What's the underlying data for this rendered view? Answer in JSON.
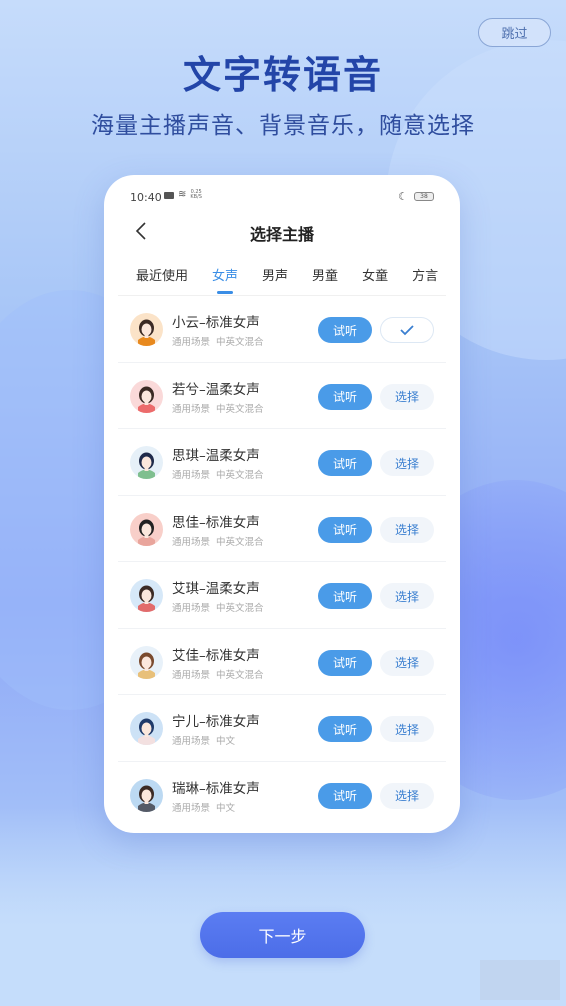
{
  "header": {
    "skip_label": "跳过",
    "title": "文字转语音",
    "subtitle": "海量主播声音、背景音乐，随意选择"
  },
  "phone": {
    "status_bar": {
      "time": "10:40",
      "net_speed_value": "0.25",
      "net_speed_unit": "KB/S",
      "battery": "38"
    },
    "nav": {
      "back_icon": "chevron-left-icon",
      "title": "选择主播"
    },
    "tabs": [
      {
        "label": "最近使用",
        "active": false
      },
      {
        "label": "女声",
        "active": true
      },
      {
        "label": "男声",
        "active": false
      },
      {
        "label": "男童",
        "active": false
      },
      {
        "label": "女童",
        "active": false
      },
      {
        "label": "方言",
        "active": false
      }
    ],
    "voices": [
      {
        "name": "小云–标准女声",
        "tags": [
          "通用场景",
          "中英文混合"
        ],
        "listen_label": "试听",
        "select_label": "✓",
        "selected": true,
        "avatar_bg": "#fbe3c8",
        "hair": "#3b2a24",
        "cloth": "#e8891e"
      },
      {
        "name": "若兮–温柔女声",
        "tags": [
          "通用场景",
          "中英文混合"
        ],
        "listen_label": "试听",
        "select_label": "选择",
        "selected": false,
        "avatar_bg": "#fad9d9",
        "hair": "#3b2a24",
        "cloth": "#ec6b6b"
      },
      {
        "name": "思琪–温柔女声",
        "tags": [
          "通用场景",
          "中英文混合"
        ],
        "listen_label": "试听",
        "select_label": "选择",
        "selected": false,
        "avatar_bg": "#e6f0f8",
        "hair": "#1f2a4a",
        "cloth": "#7fbf8f"
      },
      {
        "name": "思佳–标准女声",
        "tags": [
          "通用场景",
          "中英文混合"
        ],
        "listen_label": "试听",
        "select_label": "选择",
        "selected": false,
        "avatar_bg": "#f8cfc9",
        "hair": "#222222",
        "cloth": "#e9a59c"
      },
      {
        "name": "艾琪–温柔女声",
        "tags": [
          "通用场景",
          "中英文混合"
        ],
        "listen_label": "试听",
        "select_label": "选择",
        "selected": false,
        "avatar_bg": "#d6e8f8",
        "hair": "#3b2a24",
        "cloth": "#e26b6b"
      },
      {
        "name": "艾佳–标准女声",
        "tags": [
          "通用场景",
          "中英文混合"
        ],
        "listen_label": "试听",
        "select_label": "选择",
        "selected": false,
        "avatar_bg": "#e8f1f9",
        "hair": "#7a4a2e",
        "cloth": "#e8c07a"
      },
      {
        "name": "宁儿–标准女声",
        "tags": [
          "通用场景",
          "中文"
        ],
        "listen_label": "试听",
        "select_label": "选择",
        "selected": false,
        "avatar_bg": "#cde2f6",
        "hair": "#1f3a6a",
        "cloth": "#f3e0e0"
      },
      {
        "name": "瑞琳–标准女声",
        "tags": [
          "通用场景",
          "中文"
        ],
        "listen_label": "试听",
        "select_label": "选择",
        "selected": false,
        "avatar_bg": "#bcd9f2",
        "hair": "#3b2a24",
        "cloth": "#555a66"
      }
    ]
  },
  "footer": {
    "next_label": "下一步"
  }
}
